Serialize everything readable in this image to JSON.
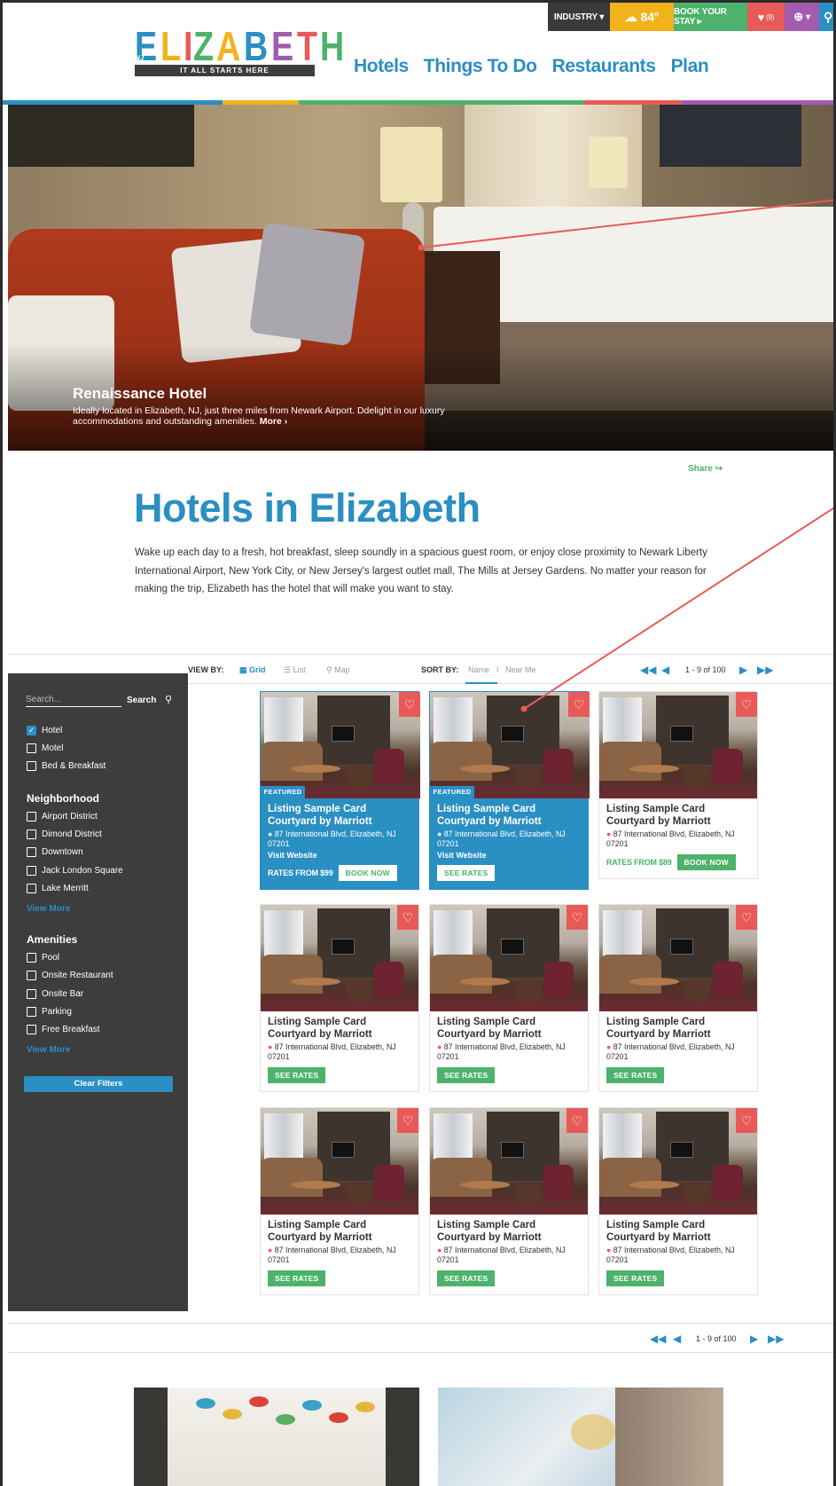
{
  "topbar": {
    "industry": "INDUSTRY ▾",
    "weather": "84°",
    "book": "BOOK YOUR STAY ▸",
    "favorites": "(9)",
    "globe": "▾"
  },
  "logo": {
    "letters": [
      "E",
      "L",
      "I",
      "Z",
      "A",
      "B",
      "E",
      "T",
      "H"
    ],
    "letter_colors": [
      "#2a8fc2",
      "#f2b21c",
      "#e85a57",
      "#4db26b",
      "#f2b21c",
      "#2a8fc2",
      "#a25bb0",
      "#e85a57",
      "#4db26b"
    ],
    "badge": "NJ",
    "tagline": "IT ALL STARTS HERE"
  },
  "nav": {
    "items": [
      "Hotels",
      "Things To Do",
      "Restaurants",
      "Plan"
    ]
  },
  "hero": {
    "title": "Renaissance Hotel",
    "description": "Ideally located in Elizabeth, NJ, just three miles from Newark Airport. Ddelight in our luxury accommodations and outstanding amenities.",
    "more": "More ›"
  },
  "intro": {
    "share": "Share ↪",
    "title": "Hotels in Elizabeth",
    "text": "Wake up each day to a fresh, hot breakfast, sleep soundly in a spacious guest room, or enjoy close proximity to Newark Liberty International Airport, New York City, or New Jersey's largest outlet mall, The Mills at Jersey Gardens. No matter your reason for making the trip, Elizabeth has the hotel that will make you want to stay."
  },
  "toolbar": {
    "view_by": "VIEW BY:",
    "grid": "Grid",
    "list": "List",
    "map": "Map",
    "sort_by": "SORT BY:",
    "sort_name": "Name",
    "sort_sep": "I",
    "sort_near": "Near Me",
    "page_info": "1 - 9 of 100"
  },
  "sidebar": {
    "search_placeholder": "Search...",
    "search_button": "Search",
    "types": [
      {
        "label": "Hotel",
        "checked": true
      },
      {
        "label": "Motel",
        "checked": false
      },
      {
        "label": "Bed & Breakfast",
        "checked": false
      }
    ],
    "neighborhood_heading": "Neighborhood",
    "neighborhoods": [
      "Airport District",
      "Dimond District",
      "Downtown",
      "Jack London Square",
      "Lake Merritt"
    ],
    "view_more": "View More",
    "amenities_heading": "Amenities",
    "amenities": [
      "Pool",
      "Onsite Restaurant",
      "Onsite Bar",
      "Parking",
      "Free Breakfast"
    ],
    "view_more_2": "View More",
    "clear": "Clear Filters"
  },
  "cards": [
    {
      "featured": true,
      "tag": "FEATURED",
      "title": "Listing Sample Card Courtyard by Marriott",
      "address": "87 International Blvd, Elizabeth, NJ 07201",
      "website": "Visit Website",
      "rates": "RATES FROM $99",
      "button": "BOOK NOW"
    },
    {
      "featured": true,
      "tag": "FEATURED",
      "title": "Listing Sample Card Courtyard by Marriott",
      "address": "87 International Blvd, Elizabeth, NJ 07201",
      "website": "Visit Website",
      "rates": "",
      "button": "SEE RATES"
    },
    {
      "featured": false,
      "tag": "",
      "title": "Listing Sample Card Courtyard by Marriott",
      "address": "87 International Blvd, Elizabeth, NJ 07201",
      "website": "",
      "rates": "RATES FROM $89",
      "button": "BOOK NOW"
    },
    {
      "featured": false,
      "tag": "",
      "title": "Listing Sample Card Courtyard by Marriott",
      "address": "87 International Blvd, Elizabeth, NJ 07201",
      "website": "",
      "rates": "",
      "button": "SEE RATES"
    },
    {
      "featured": false,
      "tag": "",
      "title": "Listing Sample Card Courtyard by Marriott",
      "address": "87 International Blvd, Elizabeth, NJ 07201",
      "website": "",
      "rates": "",
      "button": "SEE RATES"
    },
    {
      "featured": false,
      "tag": "",
      "title": "Listing Sample Card Courtyard by Marriott",
      "address": "87 International Blvd, Elizabeth, NJ 07201",
      "website": "",
      "rates": "",
      "button": "SEE RATES"
    },
    {
      "featured": false,
      "tag": "",
      "title": "Listing Sample Card Courtyard by Marriott",
      "address": "87 International Blvd, Elizabeth, NJ 07201",
      "website": "",
      "rates": "",
      "button": "SEE RATES"
    },
    {
      "featured": false,
      "tag": "",
      "title": "Listing Sample Card Courtyard by Marriott",
      "address": "87 International Blvd, Elizabeth, NJ 07201",
      "website": "",
      "rates": "",
      "button": "SEE RATES"
    },
    {
      "featured": false,
      "tag": "",
      "title": "Listing Sample Card Courtyard by Marriott",
      "address": "87 International Blvd, Elizabeth, NJ 07201",
      "website": "",
      "rates": "",
      "button": "SEE RATES"
    }
  ],
  "bottom_pagination": {
    "page_info": "1 - 9 of 100"
  },
  "colors": {
    "blue": "#2a8fc2",
    "green": "#4db26b",
    "yellow": "#f2b21c",
    "red": "#e85a57",
    "purple": "#a25bb0",
    "dark": "#3d3d3d"
  },
  "icons": {
    "heart": "heart-icon",
    "globe": "globe-icon",
    "search": "search-icon",
    "weather": "sun-cloud-icon",
    "pin": "map-pin-icon",
    "grid": "grid-icon",
    "list": "list-icon",
    "map": "map-marker-icon",
    "first": "first-page-icon",
    "prev": "prev-page-icon",
    "next": "next-page-icon",
    "last": "last-page-icon"
  }
}
